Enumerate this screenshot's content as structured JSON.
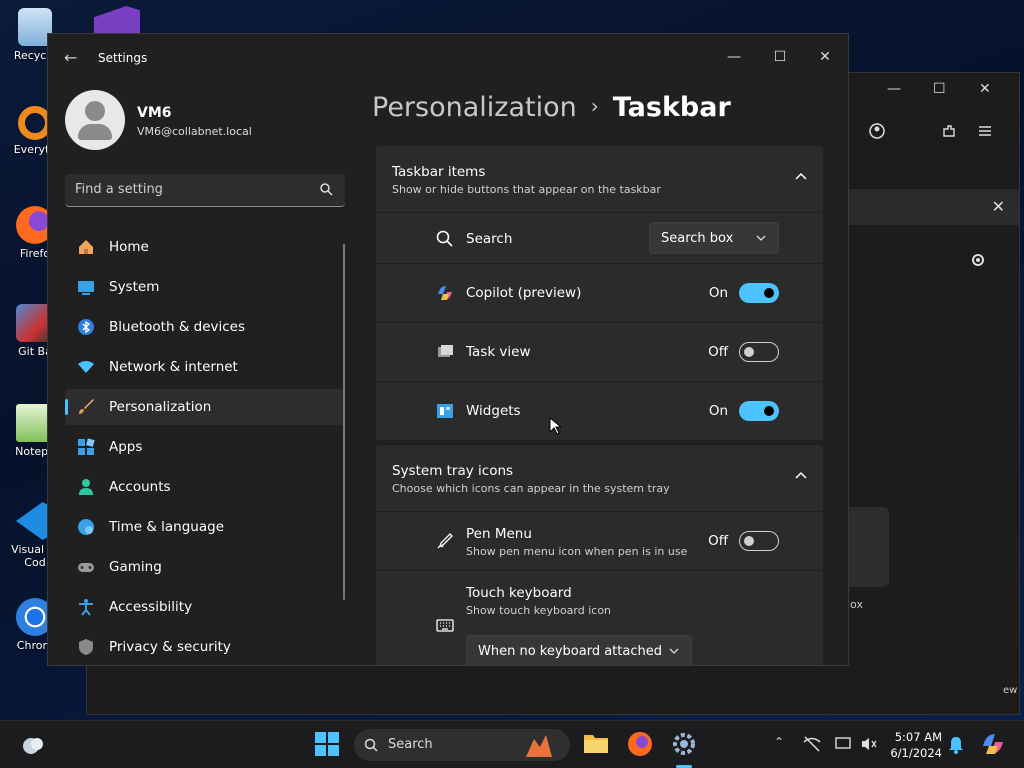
{
  "desktop": {
    "icons": [
      {
        "label": "Recycle"
      },
      {
        "label": "Everyth"
      },
      {
        "label": "Firefo"
      },
      {
        "label": "Git Ba"
      },
      {
        "label": "Notepa"
      },
      {
        "label": "Visual St Cod"
      },
      {
        "label": "Chrom"
      }
    ]
  },
  "background_window": {
    "tile_label": "lox",
    "edge_text": "ew"
  },
  "settings": {
    "title": "Settings",
    "user": {
      "name": "VM6",
      "email": "VM6@collabnet.local"
    },
    "search_placeholder": "Find a setting",
    "nav": [
      {
        "label": "Home",
        "icon": "home-icon"
      },
      {
        "label": "System",
        "icon": "system-icon"
      },
      {
        "label": "Bluetooth & devices",
        "icon": "bluetooth-icon"
      },
      {
        "label": "Network & internet",
        "icon": "network-icon"
      },
      {
        "label": "Personalization",
        "icon": "brush-icon"
      },
      {
        "label": "Apps",
        "icon": "apps-icon"
      },
      {
        "label": "Accounts",
        "icon": "accounts-icon"
      },
      {
        "label": "Time & language",
        "icon": "globe-icon"
      },
      {
        "label": "Gaming",
        "icon": "gamepad-icon"
      },
      {
        "label": "Accessibility",
        "icon": "accessibility-icon"
      },
      {
        "label": "Privacy & security",
        "icon": "shield-icon"
      }
    ],
    "active_nav": "Personalization",
    "breadcrumb": {
      "parent": "Personalization",
      "separator": "›",
      "current": "Taskbar"
    },
    "taskbar_items": {
      "title": "Taskbar items",
      "subtitle": "Show or hide buttons that appear on the taskbar",
      "search": {
        "label": "Search",
        "value": "Search box"
      },
      "copilot": {
        "label": "Copilot (preview)",
        "state": "On"
      },
      "taskview": {
        "label": "Task view",
        "state": "Off"
      },
      "widgets": {
        "label": "Widgets",
        "state": "On"
      }
    },
    "system_tray": {
      "title": "System tray icons",
      "subtitle": "Choose which icons can appear in the system tray",
      "pen_menu": {
        "label": "Pen Menu",
        "desc": "Show pen menu icon when pen is in use",
        "state": "Off"
      },
      "touch_keyboard": {
        "label": "Touch keyboard",
        "desc": "Show touch keyboard icon",
        "value": "When no keyboard attached"
      }
    }
  },
  "taskbar": {
    "search_label": "Search",
    "time": "5:07 AM",
    "date": "6/1/2024",
    "colors": {
      "accent": "#4cc2ff",
      "toggle_on": "#4cc2ff"
    }
  }
}
